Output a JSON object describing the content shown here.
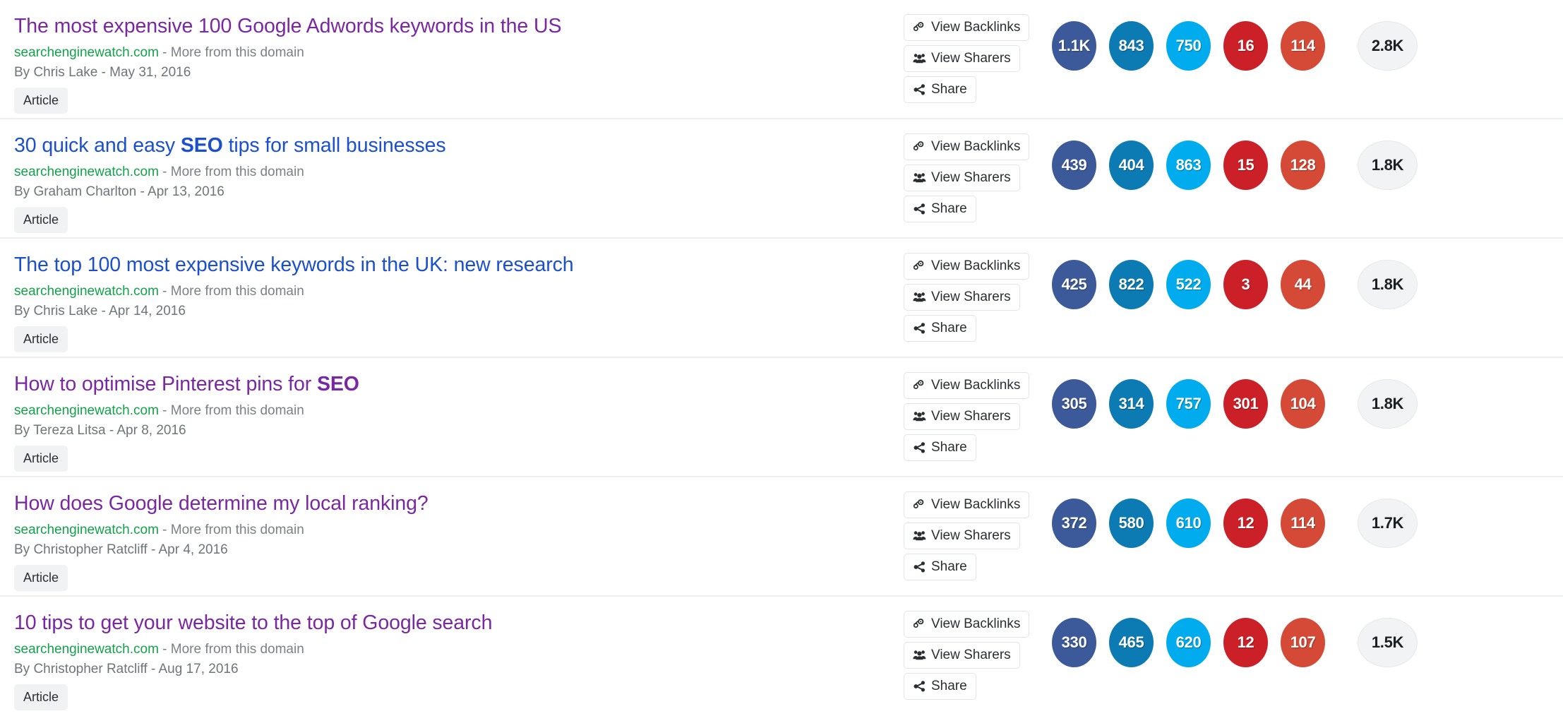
{
  "colors": {
    "facebook": "#3c5a99",
    "linkedin": "#0c7bb3",
    "twitter": "#00acee",
    "pinterest": "#cb2027",
    "googleplus": "#d44a36",
    "total_bg": "#f2f3f4",
    "visited_link": "#7a27a3",
    "unvisited_link": "#1a4fd0",
    "domain_green": "#12a249",
    "meta_gray": "#7c8085",
    "row_divider": "#eceef0"
  },
  "labels": {
    "view_backlinks": "View Backlinks",
    "view_sharers": "View Sharers",
    "share": "Share",
    "more_from_domain": "More from this domain",
    "separator": "-",
    "backlinks_icon": "link-chain-icon",
    "sharers_icon": "users-group-icon",
    "share_icon": "share-nodes-icon"
  },
  "metric_names": [
    "facebook-shares",
    "linkedin-shares",
    "twitter-shares",
    "pinterest-shares",
    "googleplus-shares",
    "total-shares"
  ],
  "results": [
    {
      "title_pre": "The most expensive 100 Google Adwords keywords in the US",
      "title_bold": "",
      "title_post": "",
      "link_state": "visited",
      "domain": "searchenginewatch.com",
      "byline": "By Chris Lake - May 31, 2016",
      "tag": "Article",
      "metrics": {
        "facebook": "1.1K",
        "linkedin": "843",
        "twitter": "750",
        "pinterest": "16",
        "googleplus": "114",
        "total": "2.8K"
      }
    },
    {
      "title_pre": "30 quick and easy ",
      "title_bold": "SEO",
      "title_post": " tips for small businesses",
      "link_state": "unvisited",
      "domain": "searchenginewatch.com",
      "byline": "By Graham Charlton - Apr 13, 2016",
      "tag": "Article",
      "metrics": {
        "facebook": "439",
        "linkedin": "404",
        "twitter": "863",
        "pinterest": "15",
        "googleplus": "128",
        "total": "1.8K"
      }
    },
    {
      "title_pre": "The top 100 most expensive keywords in the UK: new research",
      "title_bold": "",
      "title_post": "",
      "link_state": "unvisited",
      "domain": "searchenginewatch.com",
      "byline": "By Chris Lake - Apr 14, 2016",
      "tag": "Article",
      "metrics": {
        "facebook": "425",
        "linkedin": "822",
        "twitter": "522",
        "pinterest": "3",
        "googleplus": "44",
        "total": "1.8K"
      }
    },
    {
      "title_pre": "How to optimise Pinterest pins for ",
      "title_bold": "SEO",
      "title_post": "",
      "link_state": "visited",
      "domain": "searchenginewatch.com",
      "byline": "By Tereza Litsa - Apr 8, 2016",
      "tag": "Article",
      "metrics": {
        "facebook": "305",
        "linkedin": "314",
        "twitter": "757",
        "pinterest": "301",
        "googleplus": "104",
        "total": "1.8K"
      }
    },
    {
      "title_pre": "How does Google determine my local ranking?",
      "title_bold": "",
      "title_post": "",
      "link_state": "visited",
      "domain": "searchenginewatch.com",
      "byline": "By Christopher Ratcliff - Apr 4, 2016",
      "tag": "Article",
      "metrics": {
        "facebook": "372",
        "linkedin": "580",
        "twitter": "610",
        "pinterest": "12",
        "googleplus": "114",
        "total": "1.7K"
      }
    },
    {
      "title_pre": "10 tips to get your website to the top of Google search",
      "title_bold": "",
      "title_post": "",
      "link_state": "visited",
      "domain": "searchenginewatch.com",
      "byline": "By Christopher Ratcliff - Aug 17, 2016",
      "tag": "Article",
      "metrics": {
        "facebook": "330",
        "linkedin": "465",
        "twitter": "620",
        "pinterest": "12",
        "googleplus": "107",
        "total": "1.5K"
      }
    }
  ]
}
